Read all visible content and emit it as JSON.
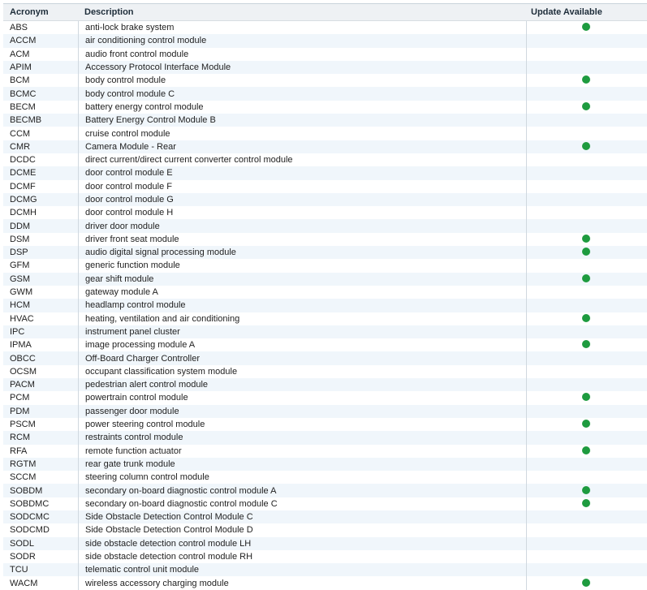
{
  "table": {
    "headers": {
      "acronym": "Acronym",
      "description": "Description",
      "update": "Update Available"
    },
    "status_color": "#1e9b3f",
    "rows": [
      {
        "acronym": "ABS",
        "description": "anti-lock brake system",
        "update": true
      },
      {
        "acronym": "ACCM",
        "description": "air conditioning control module",
        "update": false
      },
      {
        "acronym": "ACM",
        "description": "audio front control module",
        "update": false
      },
      {
        "acronym": "APIM",
        "description": "Accessory Protocol Interface Module",
        "update": false
      },
      {
        "acronym": "BCM",
        "description": "body control module",
        "update": true
      },
      {
        "acronym": "BCMC",
        "description": "body control module C",
        "update": false
      },
      {
        "acronym": "BECM",
        "description": "battery energy control module",
        "update": true
      },
      {
        "acronym": "BECMB",
        "description": "Battery Energy Control Module B",
        "update": false
      },
      {
        "acronym": "CCM",
        "description": "cruise control module",
        "update": false
      },
      {
        "acronym": "CMR",
        "description": "Camera Module - Rear",
        "update": true
      },
      {
        "acronym": "DCDC",
        "description": "direct current/direct current converter control module",
        "update": false
      },
      {
        "acronym": "DCME",
        "description": "door control module E",
        "update": false
      },
      {
        "acronym": "DCMF",
        "description": "door control module F",
        "update": false
      },
      {
        "acronym": "DCMG",
        "description": "door control module G",
        "update": false
      },
      {
        "acronym": "DCMH",
        "description": "door control module H",
        "update": false
      },
      {
        "acronym": "DDM",
        "description": "driver door module",
        "update": false
      },
      {
        "acronym": "DSM",
        "description": "driver front seat module",
        "update": true
      },
      {
        "acronym": "DSP",
        "description": "audio digital signal processing module",
        "update": true
      },
      {
        "acronym": "GFM",
        "description": "generic function module",
        "update": false
      },
      {
        "acronym": "GSM",
        "description": "gear shift module",
        "update": true
      },
      {
        "acronym": "GWM",
        "description": "gateway module A",
        "update": false
      },
      {
        "acronym": "HCM",
        "description": "headlamp control module",
        "update": false
      },
      {
        "acronym": "HVAC",
        "description": "heating, ventilation and air conditioning",
        "update": true
      },
      {
        "acronym": "IPC",
        "description": "instrument panel cluster",
        "update": false
      },
      {
        "acronym": "IPMA",
        "description": "image processing module A",
        "update": true
      },
      {
        "acronym": "OBCC",
        "description": "Off-Board Charger Controller",
        "update": false
      },
      {
        "acronym": "OCSM",
        "description": "occupant classification system module",
        "update": false
      },
      {
        "acronym": "PACM",
        "description": "pedestrian alert control module",
        "update": false
      },
      {
        "acronym": "PCM",
        "description": "powertrain control module",
        "update": true
      },
      {
        "acronym": "PDM",
        "description": "passenger door module",
        "update": false
      },
      {
        "acronym": "PSCM",
        "description": "power steering control module",
        "update": true
      },
      {
        "acronym": "RCM",
        "description": "restraints control module",
        "update": false
      },
      {
        "acronym": "RFA",
        "description": "remote function actuator",
        "update": true
      },
      {
        "acronym": "RGTM",
        "description": "rear gate trunk module",
        "update": false
      },
      {
        "acronym": "SCCM",
        "description": "steering column control module",
        "update": false
      },
      {
        "acronym": "SOBDM",
        "description": "secondary on-board diagnostic control module A",
        "update": true
      },
      {
        "acronym": "SOBDMC",
        "description": "secondary on-board diagnostic control module C",
        "update": true
      },
      {
        "acronym": "SODCMC",
        "description": "Side Obstacle Detection Control Module C",
        "update": false
      },
      {
        "acronym": "SODCMD",
        "description": "Side Obstacle Detection Control Module D",
        "update": false
      },
      {
        "acronym": "SODL",
        "description": "side obstacle detection control module LH",
        "update": false
      },
      {
        "acronym": "SODR",
        "description": "side obstacle detection control module RH",
        "update": false
      },
      {
        "acronym": "TCU",
        "description": "telematic control unit module",
        "update": false
      },
      {
        "acronym": "WACM",
        "description": "wireless accessory charging module",
        "update": true
      }
    ]
  }
}
